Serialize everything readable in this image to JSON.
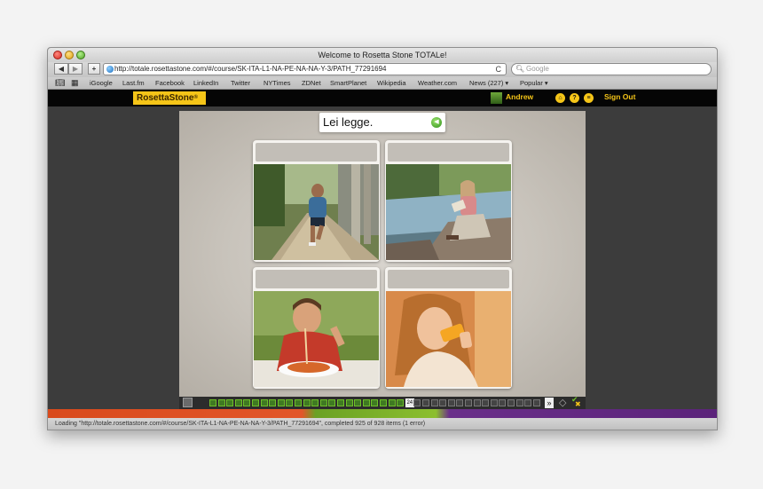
{
  "window": {
    "title": "Welcome to Rosetta Stone TOTALe!"
  },
  "toolbar": {
    "back_icon": "back-arrow-icon",
    "forward_icon": "forward-arrow-icon",
    "add_label": "+",
    "url": "http://totale.rosettastone.com/#/course/SK-ITA-L1-NA-PE-NA-NA-Y-3/PATH_77291694",
    "reload_glyph": "C",
    "search_placeholder": "Google"
  },
  "bookmarks": {
    "items": [
      "iGoogle",
      "Last.fm",
      "Facebook",
      "LinkedIn",
      "Twitter",
      "NYTimes",
      "ZDNet",
      "SmartPlanet",
      "Wikipedia",
      "Weather.com",
      "News (227) ▾",
      "Popular ▾"
    ]
  },
  "app": {
    "logo": "RosettaStone",
    "logo_mark": "®",
    "user_name": "Andrew",
    "home_icon": "home-icon",
    "help_label": "?",
    "menu_label": "≡",
    "sign_out": "Sign Out"
  },
  "lesson": {
    "prompt": "Lei legge.",
    "speaker_icon": "speaker-icon",
    "cards": [
      {
        "scene": "man-running-in-park"
      },
      {
        "scene": "woman-reading-by-river"
      },
      {
        "scene": "boy-eating-spaghetti"
      },
      {
        "scene": "woman-drinking-orange-juice"
      }
    ]
  },
  "nav": {
    "current_screen": "24",
    "next_label": "»",
    "total_screens": 39,
    "completed_screens": 23
  },
  "status": {
    "text": "Loading \"http://totale.rosettastone.com/#/course/SK-ITA-L1-NA-PE-NA-NA-Y-3/PATH_77291694\", completed 925 of 928 items (1 error)"
  },
  "colors": {
    "brand_yellow": "#f5c518",
    "app_bar": "#050505",
    "progress_orange": "#e2562a",
    "progress_green": "#8cbf2f",
    "progress_purple": "#6a2f8a"
  }
}
